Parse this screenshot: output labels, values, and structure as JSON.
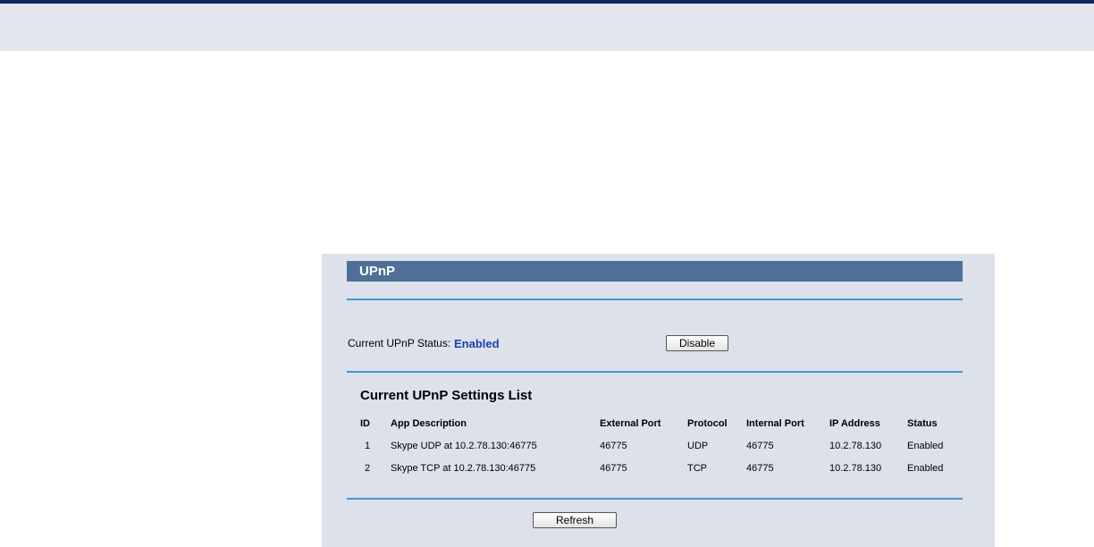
{
  "upnp": {
    "title": "UPnP",
    "status_label": "Current UPnP Status:",
    "status_value": "Enabled",
    "disable_label": "Disable",
    "list_title": "Current UPnP Settings List",
    "refresh_label": "Refresh",
    "columns": [
      "ID",
      "App Description",
      "External Port",
      "Protocol",
      "Internal Port",
      "IP Address",
      "Status"
    ],
    "rows": [
      {
        "id": "1",
        "desc": "Skype UDP at 10.2.78.130:46775",
        "ext_port": "46775",
        "protocol": "UDP",
        "int_port": "46775",
        "ip": "10.2.78.130",
        "status": "Enabled"
      },
      {
        "id": "2",
        "desc": "Skype TCP at 10.2.78.130:46775",
        "ext_port": "46775",
        "protocol": "TCP",
        "int_port": "46775",
        "ip": "10.2.78.130",
        "status": "Enabled"
      }
    ]
  },
  "colors": {
    "title_bar": "#4f6f96",
    "rule": "#3d9bd1",
    "status_value": "#1a3fb0",
    "panel_bg": "#dde1ea"
  }
}
